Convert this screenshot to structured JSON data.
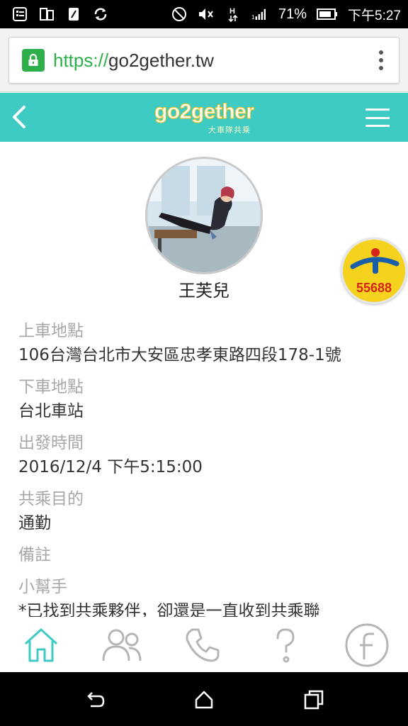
{
  "statusbar": {
    "battery_percent": "71%",
    "time": "下午5:27"
  },
  "browser": {
    "url_scheme": "https://",
    "url_host": "go2gether.tw"
  },
  "appbar": {
    "logo_text": "go2gether",
    "logo_subtitle": "大車隊共乘"
  },
  "profile": {
    "name": "王芙兒"
  },
  "badge": {
    "number": "55688"
  },
  "details": [
    {
      "label": "上車地點",
      "value": "106台灣台北市大安區忠孝東路四段178-1號"
    },
    {
      "label": "下車地點",
      "value": "台北車站"
    },
    {
      "label": "出發時間",
      "value": "2016/12/4 下午5:15:00"
    },
    {
      "label": "共乘目的",
      "value": "通勤"
    },
    {
      "label": "備註",
      "value": ""
    },
    {
      "label": "小幫手",
      "value": "*已找到共乘夥伴，卻還是一直收到共乘聯"
    }
  ],
  "colors": {
    "accent": "#3dcbc3",
    "lock_green": "#2db04a",
    "badge_yellow": "#f4d21e",
    "badge_red": "#d7231c",
    "label_gray": "#a8a8a8"
  },
  "bottomnav": {
    "items": [
      "home-icon",
      "users-icon",
      "phone-icon",
      "help-icon",
      "facebook-icon"
    ],
    "active": "home-icon"
  }
}
